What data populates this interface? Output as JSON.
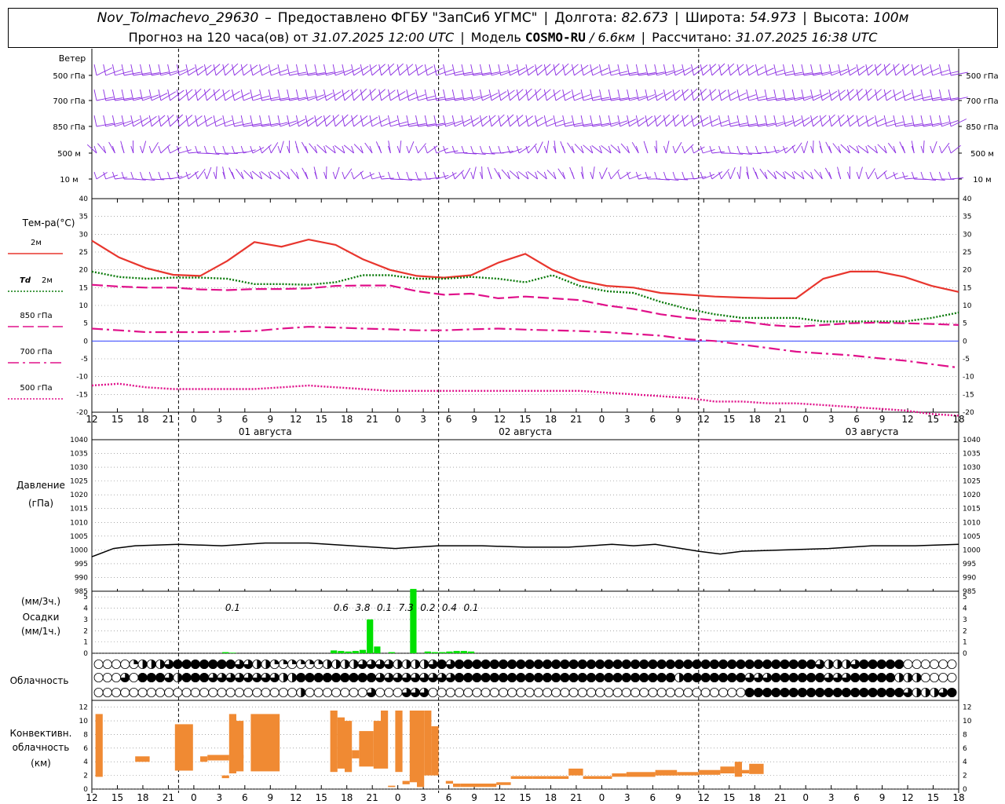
{
  "header": {
    "station": "Nov_Tolmachevo_29630",
    "dash": "–",
    "provider": "Предоставлено ФГБУ \"ЗапСиб УГМС\"",
    "lon_label": "Долгота:",
    "lon": "82.673",
    "lat_label": "Широта:",
    "lat": "54.973",
    "alt_label": "Высота:",
    "alt": "100м",
    "forecast_prefix": "Прогноз на 120 часа(ов) от",
    "forecast_time": "31.07.2025 12:00 UTC",
    "model_label": "Модель",
    "model": "COSMO-RU",
    "resolution": "/ 6.6км",
    "computed_label": "Рассчитано:",
    "computed_time": "31.07.2025 16:38 UTC",
    "sep": "|"
  },
  "chart_data": [
    {
      "type": "barbs",
      "title": "Ветер",
      "levels": [
        "500 гПа",
        "700 гПа",
        "850 гПа",
        "500 м",
        "10 м"
      ]
    },
    {
      "type": "line",
      "title": "Тем-ра(°С)",
      "ylim": [
        -20,
        40
      ],
      "yticks": [
        -20,
        -15,
        -10,
        -5,
        0,
        5,
        10,
        15,
        20,
        25,
        30,
        35,
        40
      ],
      "x_hours": [
        0,
        6,
        12,
        18,
        24,
        30,
        36,
        42,
        48,
        54,
        60,
        66,
        72,
        78,
        84,
        90,
        96,
        102,
        108,
        114,
        120
      ],
      "x_tick_labels": [
        "12",
        "15",
        "18",
        "21",
        "0",
        "3",
        "6",
        "9",
        "12",
        "15",
        "18",
        "21",
        "0",
        "3",
        "6",
        "9",
        "12",
        "15",
        "18",
        "21",
        "0",
        "3",
        "6",
        "9",
        "12",
        "15",
        "18",
        "21",
        "0",
        "3",
        "6",
        "9",
        "12",
        "15",
        "18"
      ],
      "day_labels": [
        "01 августа",
        "02 августа",
        "03 августа"
      ],
      "series": [
        {
          "name": "2м",
          "color": "#e8362e",
          "style": "solid",
          "values": [
            28.2,
            23.5,
            20.5,
            18.6,
            18.3,
            22.5,
            27.8,
            26.5,
            28.5,
            27.0,
            23.0,
            20.0,
            18.3,
            17.8,
            18.5,
            22.0,
            24.5,
            20.0,
            17.0,
            15.5,
            15.0,
            13.5,
            13.0,
            12.5,
            12.2,
            12.0,
            12.0,
            17.5,
            19.5,
            19.5,
            18.0,
            15.5,
            13.8
          ]
        },
        {
          "name": "Td 2м",
          "color": "#0a7a0a",
          "style": "dotted",
          "values": [
            19.5,
            18.0,
            17.5,
            17.8,
            17.8,
            17.5,
            16.0,
            16.0,
            15.8,
            16.5,
            18.5,
            18.5,
            17.5,
            17.5,
            18.0,
            17.5,
            16.5,
            18.5,
            15.5,
            14.0,
            13.5,
            11.0,
            9.0,
            7.5,
            6.5,
            6.5,
            6.5,
            5.5,
            5.5,
            5.5,
            5.5,
            6.5,
            8.0
          ]
        },
        {
          "name": "850 гПа",
          "color": "#e0108a",
          "style": "longdash",
          "values": [
            15.8,
            15.3,
            15.0,
            15.0,
            14.5,
            14.3,
            14.6,
            14.6,
            14.8,
            15.5,
            15.6,
            15.6,
            14.0,
            13.0,
            13.3,
            12.0,
            12.5,
            12.0,
            11.5,
            10.0,
            9.0,
            7.5,
            6.5,
            5.8,
            5.5,
            4.5,
            4.0,
            4.5,
            5.0,
            5.2,
            5.0,
            4.8,
            4.5
          ]
        },
        {
          "name": "700 гПа",
          "color": "#e0108a",
          "style": "dashdot",
          "values": [
            3.5,
            3.0,
            2.5,
            2.5,
            2.5,
            2.6,
            2.8,
            3.5,
            4.0,
            3.8,
            3.5,
            3.3,
            3.0,
            3.0,
            3.3,
            3.5,
            3.2,
            3.0,
            2.8,
            2.5,
            2.0,
            1.5,
            0.5,
            0.0,
            -1.0,
            -2.0,
            -3.0,
            -3.5,
            -4.0,
            -4.8,
            -5.5,
            -6.5,
            -7.5
          ]
        },
        {
          "name": "500 гПа",
          "color": "#e0108a",
          "style": "dotted",
          "values": [
            -12.5,
            -12.0,
            -13.0,
            -13.5,
            -13.5,
            -13.5,
            -13.5,
            -13.0,
            -12.5,
            -13.0,
            -13.5,
            -14.0,
            -14.0,
            -14.0,
            -14.0,
            -14.0,
            -14.0,
            -14.0,
            -14.0,
            -14.5,
            -15.0,
            -15.5,
            -16.0,
            -17.0,
            -17.0,
            -17.5,
            -17.5,
            -18.0,
            -18.5,
            -19.0,
            -19.5,
            -20.5,
            -21.0
          ]
        }
      ],
      "legend_labels": {
        "t2m": "2м",
        "td_prefix": "Td",
        "td_suffix": "2м",
        "t850": "850 гПа",
        "t700": "700 гПа",
        "t500": "500 гПа"
      }
    },
    {
      "type": "line",
      "title": "Давление",
      "unit": "(гПа)",
      "ylim": [
        985,
        1040
      ],
      "yticks": [
        985,
        990,
        995,
        1000,
        1005,
        1010,
        1015,
        1020,
        1025,
        1030,
        1035,
        1040
      ],
      "x_hours": [
        0,
        3,
        6,
        12,
        18,
        24,
        30,
        36,
        42,
        48,
        54,
        60,
        66,
        72,
        75,
        78,
        84,
        87,
        90,
        96,
        102,
        108,
        114,
        120
      ],
      "values": [
        997.5,
        1000.5,
        1001.5,
        1002.0,
        1001.5,
        1002.5,
        1002.5,
        1001.5,
        1000.5,
        1001.5,
        1001.5,
        1001.0,
        1001.0,
        1002.0,
        1001.5,
        1002.0,
        999.5,
        998.5,
        999.5,
        1000.0,
        1000.5,
        1001.5,
        1001.5,
        1002.0
      ]
    },
    {
      "type": "bar",
      "title": "Осадки",
      "unit_3h": "(мм/3ч.)",
      "unit_1h": "(мм/1ч.)",
      "ylim": [
        0,
        5.5
      ],
      "yticks": [
        0,
        1,
        2,
        3,
        4,
        5
      ],
      "hourly_values": [
        {
          "hour": 18,
          "value": 0.1
        },
        {
          "hour": 19,
          "value": 0.05
        },
        {
          "hour": 33,
          "value": 0.25
        },
        {
          "hour": 34,
          "value": 0.2
        },
        {
          "hour": 35,
          "value": 0.15
        },
        {
          "hour": 36,
          "value": 0.2
        },
        {
          "hour": 37,
          "value": 0.3
        },
        {
          "hour": 38,
          "value": 3.0
        },
        {
          "hour": 39,
          "value": 0.6
        },
        {
          "hour": 41,
          "value": 0.1
        },
        {
          "hour": 44,
          "value": 5.7
        },
        {
          "hour": 46,
          "value": 0.15
        },
        {
          "hour": 47,
          "value": 0.1
        },
        {
          "hour": 48,
          "value": 0.1
        },
        {
          "hour": 49,
          "value": 0.15
        },
        {
          "hour": 50,
          "value": 0.2
        },
        {
          "hour": 51,
          "value": 0.2
        },
        {
          "hour": 52,
          "value": 0.15
        }
      ],
      "totals_3h": [
        {
          "hour": 19.5,
          "label": "0.1"
        },
        {
          "hour": 34.5,
          "label": "0.6"
        },
        {
          "hour": 37.5,
          "label": "3.8"
        },
        {
          "hour": 40.5,
          "label": "0.1"
        },
        {
          "hour": 43.5,
          "label": "7.3"
        },
        {
          "hour": 46.5,
          "label": "0.2"
        },
        {
          "hour": 49.5,
          "label": "0.4"
        },
        {
          "hour": 52.5,
          "label": "0.1"
        }
      ]
    },
    {
      "type": "table",
      "title": "Облачность",
      "rows": [
        "00001222344444443322111111222233332222343444444444444444444444444444444444444444443222344444000000000000000000000000000",
        "00030444324443333333322444444444333333333444444444444444444444444424444444333444444333444442220000000000000444444444444",
        "00000000000000000000000200000003000333000000000000000000000000000000000000444444444444444444322234444444444433000000000000000000000000000000200002111100000"
      ]
    },
    {
      "type": "bar",
      "title": "Конвективн. облачность",
      "unit": "(км)",
      "ylim": [
        0,
        13
      ],
      "yticks": [
        0,
        2,
        4,
        6,
        8,
        10,
        12
      ],
      "floating_bars": [
        {
          "h0": 0.5,
          "h1": 1.5,
          "base": 1.8,
          "top": 11.0
        },
        {
          "h0": 6.0,
          "h1": 8.0,
          "base": 4.0,
          "top": 4.8
        },
        {
          "h0": 11.5,
          "h1": 14.0,
          "base": 2.7,
          "top": 9.5
        },
        {
          "h0": 15.0,
          "h1": 16.0,
          "base": 4.0,
          "top": 4.8
        },
        {
          "h0": 16.0,
          "h1": 19.0,
          "base": 4.2,
          "top": 5.0
        },
        {
          "h0": 19.0,
          "h1": 21.0,
          "base": 4.5,
          "top": 5.0
        },
        {
          "h0": 18.0,
          "h1": 19.0,
          "base": 1.6,
          "top": 2.0
        },
        {
          "h0": 19.0,
          "h1": 20.0,
          "base": 2.3,
          "top": 11.0
        },
        {
          "h0": 20.0,
          "h1": 21.0,
          "base": 2.6,
          "top": 10.0
        },
        {
          "h0": 22.0,
          "h1": 25.0,
          "base": 2.6,
          "top": 11.0
        },
        {
          "h0": 25.0,
          "h1": 26.0,
          "base": 2.6,
          "top": 11.0
        },
        {
          "h0": 33.0,
          "h1": 34.0,
          "base": 2.5,
          "top": 11.5
        },
        {
          "h0": 34.0,
          "h1": 35.0,
          "base": 3.0,
          "top": 10.5
        },
        {
          "h0": 35.0,
          "h1": 36.0,
          "base": 2.5,
          "top": 10.0
        },
        {
          "h0": 36.0,
          "h1": 37.0,
          "base": 4.5,
          "top": 5.7
        },
        {
          "h0": 37.0,
          "h1": 39.0,
          "base": 3.3,
          "top": 8.5
        },
        {
          "h0": 39.0,
          "h1": 40.0,
          "base": 3.0,
          "top": 10.0
        },
        {
          "h0": 40.0,
          "h1": 41.0,
          "base": 3.0,
          "top": 11.5
        },
        {
          "h0": 41.0,
          "h1": 42.0,
          "base": 0.3,
          "top": 0.5
        },
        {
          "h0": 42.0,
          "h1": 43.0,
          "base": 2.5,
          "top": 11.5
        },
        {
          "h0": 43.0,
          "h1": 44.0,
          "base": 0.7,
          "top": 1.2
        },
        {
          "h0": 44.0,
          "h1": 45.0,
          "base": 1.0,
          "top": 11.5
        },
        {
          "h0": 45.0,
          "h1": 46.0,
          "base": 0.3,
          "top": 11.5
        },
        {
          "h0": 46.0,
          "h1": 47.0,
          "base": 2.0,
          "top": 11.5
        },
        {
          "h0": 47.0,
          "h1": 48.0,
          "base": 2.0,
          "top": 9.2
        },
        {
          "h0": 49.0,
          "h1": 50.0,
          "base": 0.8,
          "top": 1.2
        },
        {
          "h0": 50.0,
          "h1": 51.0,
          "base": 0.3,
          "top": 0.8
        },
        {
          "h0": 51.0,
          "h1": 56.0,
          "base": 0.3,
          "top": 0.8
        },
        {
          "h0": 56.0,
          "h1": 58.0,
          "base": 0.6,
          "top": 1.0
        },
        {
          "h0": 58.0,
          "h1": 61.0,
          "base": 1.5,
          "top": 1.9
        },
        {
          "h0": 61.0,
          "h1": 63.0,
          "base": 1.5,
          "top": 1.9
        },
        {
          "h0": 63.0,
          "h1": 66.0,
          "base": 1.5,
          "top": 1.9
        },
        {
          "h0": 66.0,
          "h1": 68.0,
          "base": 2.0,
          "top": 3.0
        },
        {
          "h0": 68.0,
          "h1": 72.0,
          "base": 1.5,
          "top": 1.9
        },
        {
          "h0": 72.0,
          "h1": 74.0,
          "base": 1.8,
          "top": 2.3
        },
        {
          "h0": 74.0,
          "h1": 78.0,
          "base": 1.8,
          "top": 2.5
        },
        {
          "h0": 78.0,
          "h1": 81.0,
          "base": 2.0,
          "top": 2.8
        },
        {
          "h0": 81.0,
          "h1": 84.0,
          "base": 2.0,
          "top": 2.5
        },
        {
          "h0": 84.0,
          "h1": 87.0,
          "base": 2.1,
          "top": 2.8
        },
        {
          "h0": 87.0,
          "h1": 89.0,
          "base": 2.3,
          "top": 3.3
        },
        {
          "h0": 89.0,
          "h1": 90.0,
          "base": 1.8,
          "top": 4.0
        },
        {
          "h0": 90.0,
          "h1": 91.0,
          "base": 2.3,
          "top": 2.8
        },
        {
          "h0": 91.0,
          "h1": 93.0,
          "base": 2.2,
          "top": 3.7
        }
      ]
    }
  ]
}
